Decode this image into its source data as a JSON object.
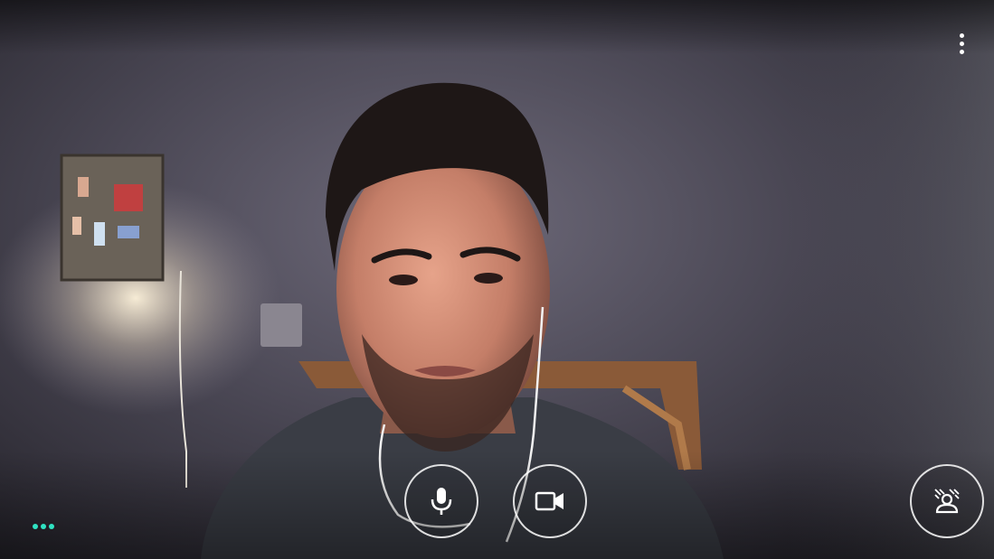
{
  "call": {
    "more_icon": "more-vert-icon",
    "controls": [
      {
        "name": "microphone",
        "icon": "mic-icon",
        "state": "on"
      },
      {
        "name": "camera",
        "icon": "videocam-icon",
        "state": "on"
      },
      {
        "name": "effects",
        "icon": "person-lighting-icon"
      }
    ],
    "status_indicator": {
      "icon": "three-dots-icon",
      "color": "#2fe3c2"
    }
  }
}
